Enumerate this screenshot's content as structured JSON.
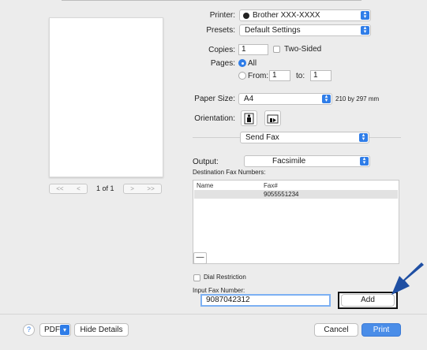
{
  "preview": {
    "page_label": "1 of 1",
    "first_prev": [
      "<<",
      "<"
    ],
    "next_last": [
      ">",
      ">>"
    ]
  },
  "printer": {
    "label": "Printer:",
    "value": "Brother XXX-XXXX"
  },
  "presets": {
    "label": "Presets:",
    "value": "Default Settings"
  },
  "copies": {
    "label": "Copies:",
    "value": "1",
    "two_sided_label": "Two-Sided"
  },
  "pages": {
    "label": "Pages:",
    "all_label": "All",
    "from_label": "From:",
    "from_value": "1",
    "to_label": "to:",
    "to_value": "1"
  },
  "paper_size": {
    "label": "Paper Size:",
    "value": "A4",
    "dims": "210 by 297 mm"
  },
  "orientation": {
    "label": "Orientation:"
  },
  "section": {
    "value": "Send Fax"
  },
  "output": {
    "label": "Output:",
    "value": "Facsimile"
  },
  "destination": {
    "label": "Destination Fax Numbers:",
    "col_name": "Name",
    "col_fax": "Fax#",
    "rows": [
      {
        "name": "",
        "fax": "9055551234"
      }
    ]
  },
  "remove_button": "—",
  "dial_restriction": "Dial Restriction",
  "input_fax": {
    "label": "Input Fax Number:",
    "value": "9087042312"
  },
  "add_button": "Add",
  "bottom": {
    "help": "?",
    "pdf": "PDF",
    "hide_details": "Hide Details",
    "cancel": "Cancel",
    "print": "Print"
  },
  "colors": {
    "accent": "#2f7de8",
    "arrow": "#1f4fa3"
  }
}
